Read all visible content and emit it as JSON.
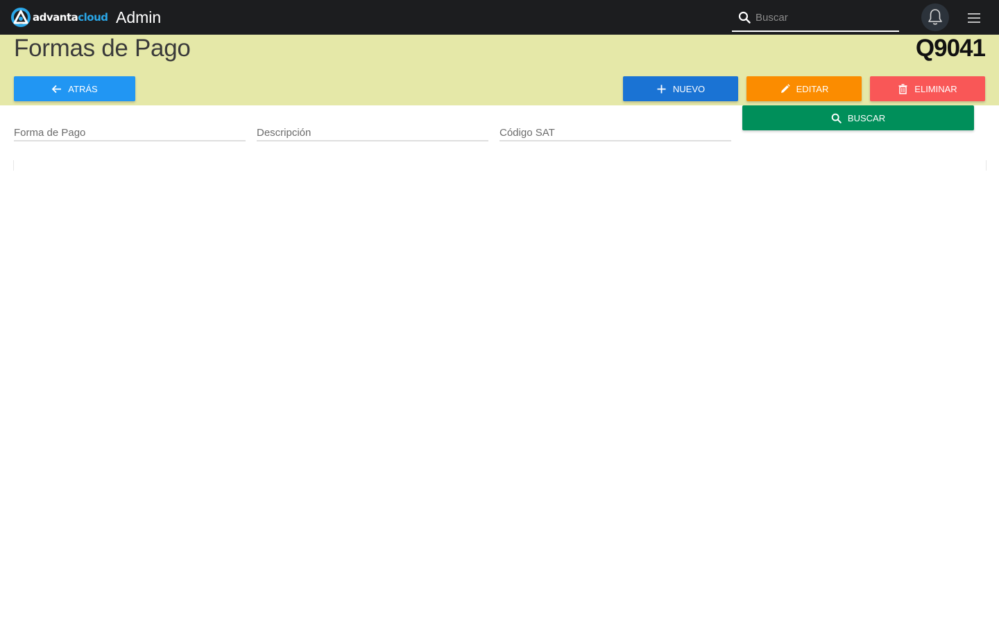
{
  "topbar": {
    "logo_text_primary": "advanta",
    "logo_text_accent": "cloud",
    "app_title": "Admin",
    "search_placeholder": "Buscar",
    "icons": [
      "search-icon",
      "bell-icon",
      "hamburger-menu-icon"
    ]
  },
  "header": {
    "page_title": "Formas de Pago",
    "company_code": "Q9041",
    "band_color": "#e5e8a8"
  },
  "actions": {
    "back_label": "ATRÁS",
    "new_label": "NUEVO",
    "edit_label": "EDITAR",
    "delete_label": "ELIMINAR",
    "search_label": "BUSCAR"
  },
  "filters": {
    "payment_method_placeholder": "Forma de Pago",
    "description_placeholder": "Descripción",
    "sat_code_placeholder": "Código SAT"
  },
  "colors": {
    "topbar": "#1c1d1f",
    "back_button": "#2196f3",
    "new_button": "#1a73d4",
    "edit_button": "#fb8c00",
    "delete_button": "#f95757",
    "search_button": "#008f5a",
    "brand_accent": "#2aa7e8"
  }
}
